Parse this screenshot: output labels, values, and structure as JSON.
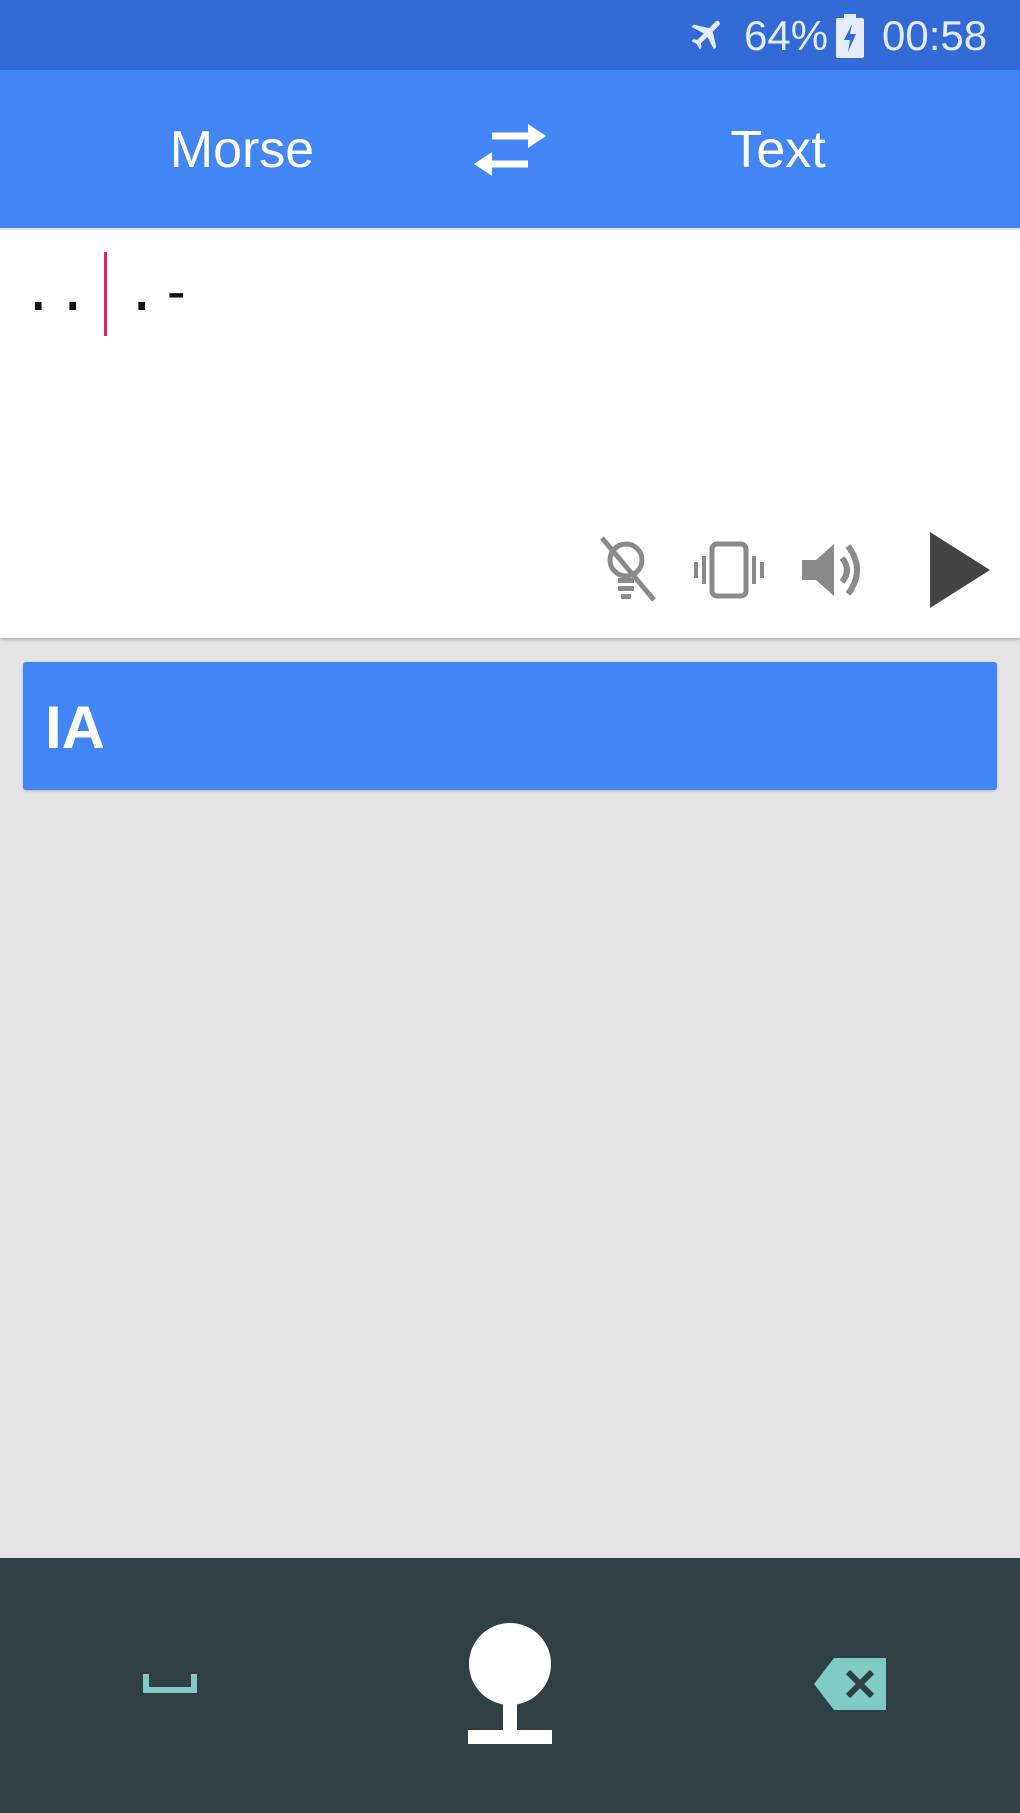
{
  "status_bar": {
    "battery_percent": "64%",
    "time": "00:58",
    "icons": [
      "airplane-mode-icon",
      "battery-charging-icon"
    ]
  },
  "app_bar": {
    "source_language": "Morse",
    "target_language": "Text",
    "swap_icon": "swap-icon"
  },
  "input": {
    "value": ".. .-",
    "controls": [
      "flashlight-off-icon",
      "vibrate-icon",
      "volume-icon",
      "play-icon"
    ]
  },
  "result": {
    "text": "IA"
  },
  "keyboard": {
    "keys": [
      "space-key-icon",
      "morse-tap-key-icon",
      "backspace-key-icon"
    ]
  },
  "colors": {
    "status_bar": "#336bd6",
    "app_bar": "#4285f4",
    "result_card": "#4285f4",
    "caret": "#e91e63",
    "background": "#e4e4e4",
    "keyboard": "#2f3f43",
    "key_accent": "#80cbc4"
  }
}
